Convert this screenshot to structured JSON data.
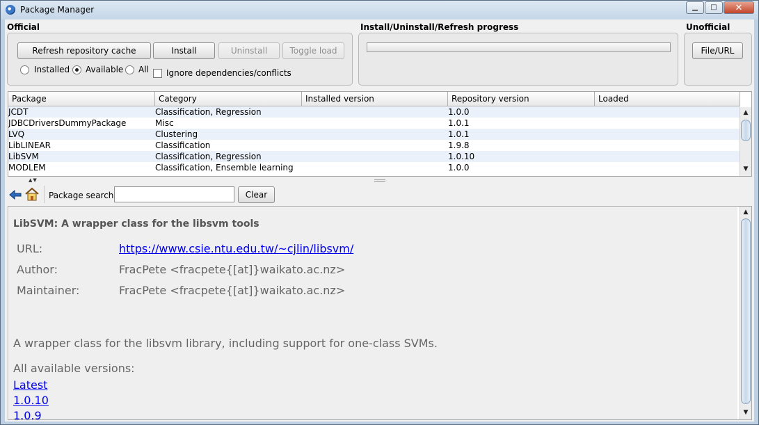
{
  "window": {
    "title": "Package Manager",
    "controls": {
      "minimize": "▁",
      "maximize": "□",
      "close": "✕"
    }
  },
  "official": {
    "title": "Official",
    "buttons": {
      "refresh": "Refresh repository cache",
      "install": "Install",
      "uninstall": "Uninstall",
      "toggle_load": "Toggle load"
    },
    "filter": {
      "options": [
        "Installed",
        "Available",
        "All"
      ],
      "selected": "Available"
    },
    "ignore_deps_label": "Ignore dependencies/conflicts",
    "ignore_deps_checked": false
  },
  "progress": {
    "title": "Install/Uninstall/Refresh progress",
    "value": 0
  },
  "unofficial": {
    "title": "Unofficial",
    "button": "File/URL"
  },
  "table": {
    "columns": [
      "Package",
      "Category",
      "Installed version",
      "Repository version",
      "Loaded"
    ],
    "rows": [
      [
        "JCDT",
        "Classification, Regression",
        "",
        "1.0.0",
        ""
      ],
      [
        "JDBCDriversDummyPackage",
        "Misc",
        "",
        "1.0.1",
        ""
      ],
      [
        "LVQ",
        "Clustering",
        "",
        "1.0.1",
        ""
      ],
      [
        "LibLINEAR",
        "Classification",
        "",
        "1.9.8",
        ""
      ],
      [
        "LibSVM",
        "Classification, Regression",
        "",
        "1.0.10",
        ""
      ],
      [
        "MODLEM",
        "Classification, Ensemble learning",
        "",
        "1.0.0",
        ""
      ]
    ]
  },
  "search": {
    "label": "Package search",
    "value": "",
    "clear": "Clear"
  },
  "details": {
    "title": "LibSVM: A wrapper class for the libsvm tools",
    "url_label": "URL:",
    "url": "https://www.csie.ntu.edu.tw/~cjlin/libsvm/",
    "author_label": "Author:",
    "author": "FracPete <fracpete{[at]}waikato.ac.nz>",
    "maintainer_label": "Maintainer:",
    "maintainer": "FracPete <fracpete{[at]}waikato.ac.nz>",
    "description": "A wrapper class for the libsvm library, including support for one-class SVMs.",
    "versions_label": "All available versions:",
    "versions": [
      "Latest",
      "1.0.10",
      "1.0.9"
    ]
  }
}
